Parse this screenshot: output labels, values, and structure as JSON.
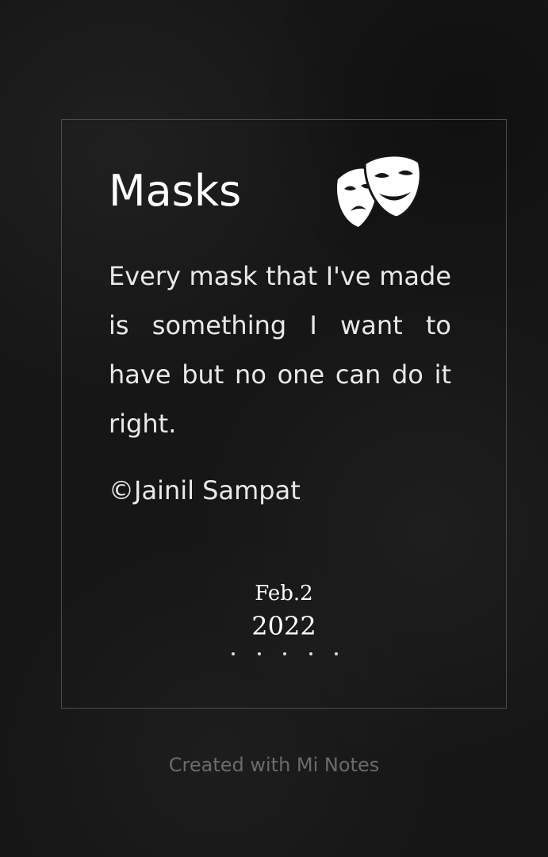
{
  "note": {
    "title": "Masks",
    "icon": "theater-masks-icon",
    "body": "Every mask that I've made is something I want to have but no one can do it right.",
    "signature": "©Jainil Sampat",
    "date": {
      "day": "Feb.2",
      "year": "2022"
    }
  },
  "footer": {
    "credit": "Created with Mi Notes"
  },
  "colors": {
    "background": "#161616",
    "text": "#ffffff",
    "frame": "#4c4c4c",
    "footer_text": "#6b6b6b"
  }
}
